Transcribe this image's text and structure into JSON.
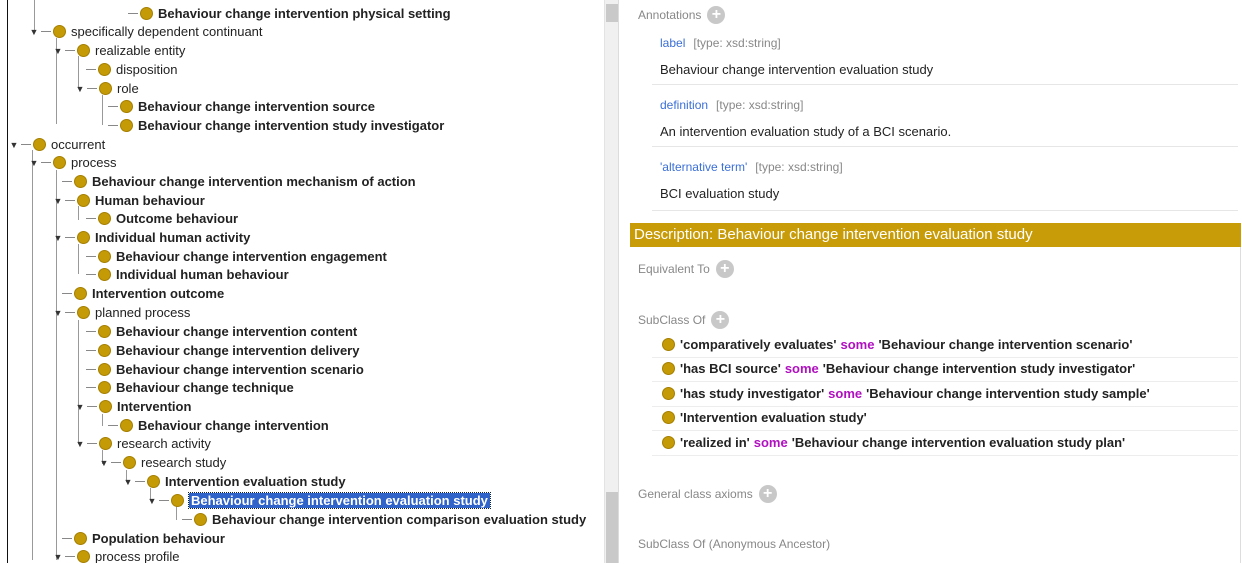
{
  "tree": {
    "n0": "Behaviour change intervention physical setting",
    "n1": "specifically dependent continuant",
    "n2": "realizable entity",
    "n3": "disposition",
    "n4": "role",
    "n5": "Behaviour change intervention source",
    "n6": "Behaviour change intervention study investigator",
    "n7": "occurrent",
    "n8": "process",
    "n9": "Behaviour change intervention mechanism of action",
    "n10": "Human behaviour",
    "n11": "Outcome behaviour",
    "n12": "Individual human activity",
    "n13": "Behaviour change intervention engagement",
    "n14": "Individual human behaviour",
    "n15": "Intervention outcome",
    "n16": "planned process",
    "n17": "Behaviour change intervention content",
    "n18": "Behaviour change intervention delivery",
    "n19": "Behaviour change intervention scenario",
    "n20": "Behaviour change technique",
    "n21": "Intervention",
    "n22": "Behaviour change intervention",
    "n23": "research activity",
    "n24": "research study",
    "n25": "Intervention evaluation study",
    "n26": "Behaviour change intervention evaluation study",
    "n27": "Behaviour change intervention comparison evaluation study",
    "n28": "Population behaviour",
    "n29": "process profile"
  },
  "annotations": {
    "header": "Annotations",
    "items": [
      {
        "prop": "label",
        "type": "[type: xsd:string]",
        "value": "Behaviour change intervention evaluation study"
      },
      {
        "prop": "definition",
        "type": "[type: xsd:string]",
        "value": "An intervention evaluation study of a BCI scenario."
      },
      {
        "prop": "'alternative term'",
        "type": "[type: xsd:string]",
        "value": "BCI evaluation study"
      }
    ]
  },
  "description": {
    "title": "Description: Behaviour change intervention evaluation study",
    "equivalent_to": "Equivalent To",
    "subclass_of": "SubClass Of",
    "general_axioms": "General class axioms",
    "anonymous_ancestor": "SubClass Of (Anonymous Ancestor)",
    "axioms": [
      {
        "pre": "'comparatively evaluates'",
        "kw": "some",
        "post": "'Behaviour change intervention scenario'"
      },
      {
        "pre": "'has BCI source'",
        "kw": "some",
        "post": "'Behaviour change intervention study investigator'"
      },
      {
        "pre": "'has study investigator'",
        "kw": "some",
        "post": "'Behaviour change intervention study sample'"
      },
      {
        "pre": "'Intervention evaluation study'",
        "kw": "",
        "post": ""
      },
      {
        "pre": "'realized in'",
        "kw": "some",
        "post": "'Behaviour change intervention evaluation study plan'"
      }
    ]
  },
  "colors": {
    "accent": "#c89b08",
    "selection": "#2f63c9",
    "keyword": "#b010c0",
    "link": "#3b6fd6"
  }
}
